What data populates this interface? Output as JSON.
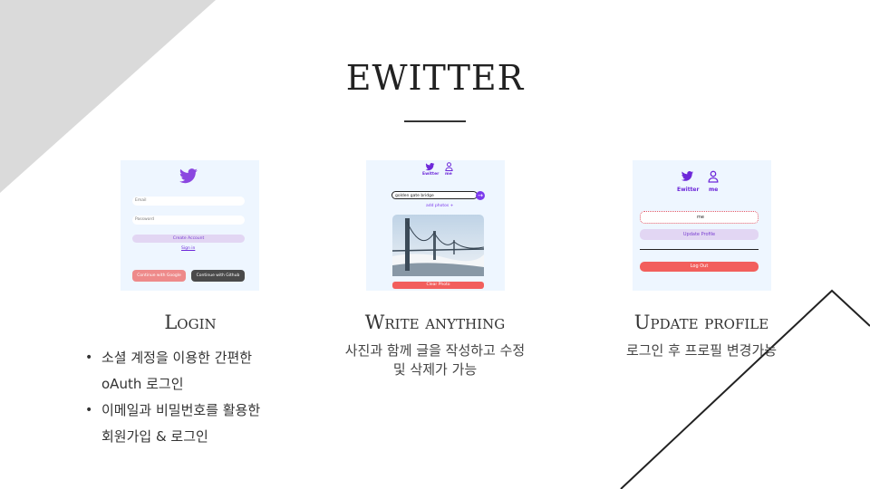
{
  "slide": {
    "title": "EWITTER",
    "colors": {
      "corner": "#dadada",
      "accent": "#7c3aed",
      "panel": "#eef6ff",
      "logout": "#f25f5c"
    }
  },
  "sections": [
    {
      "heading": "Login",
      "mock": {
        "logo": "twitter-bird-icon",
        "email_placeholder": "Email",
        "password_placeholder": "Password",
        "create_account": "Create Account",
        "sign_in": "Sign in",
        "google_button": "Continue with Google",
        "github_button": "Continue with Github"
      },
      "bullets": [
        {
          "line1": "소셜 계정을 이용한 간편한",
          "line2": "oAuth 로그인"
        },
        {
          "line1": "이메일과 비밀번호를 활용한",
          "line2": "회원가입 & 로그인"
        }
      ]
    },
    {
      "heading": "Write anything",
      "mock": {
        "nav_home": "Ewitter",
        "nav_me": "me",
        "tweet_value": "golden gate bridge",
        "submit_icon": "arrow-right-icon",
        "add_photos": "add photos +",
        "photo": "golden-gate-bridge-photo",
        "clear_photo": "Clear Photo"
      },
      "description_line1": "사진과 함께 글을 작성하고 수정",
      "description_line2": "및 삭제가 가능"
    },
    {
      "heading": "Update profile",
      "mock": {
        "nav_home": "Ewitter",
        "nav_me": "me",
        "name_value": "me",
        "update_profile": "Update Profile",
        "log_out": "Log Out"
      },
      "description": "로그인 후 프로필 변경가능"
    }
  ]
}
